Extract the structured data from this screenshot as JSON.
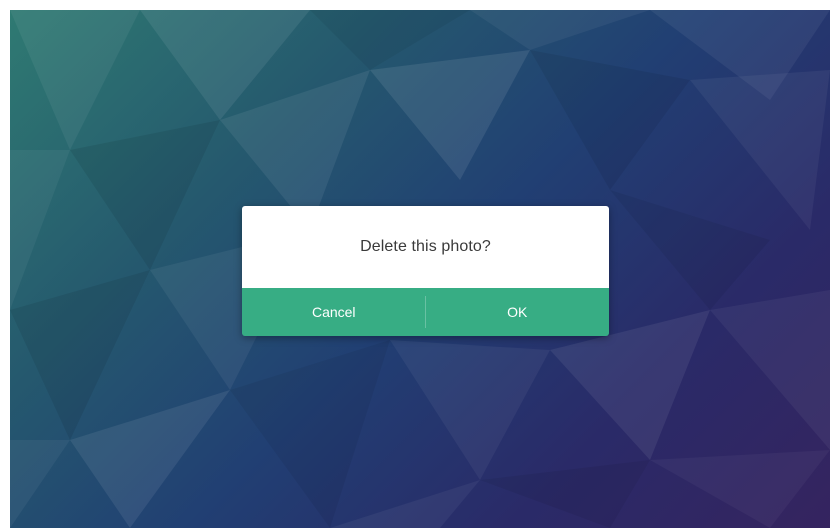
{
  "dialog": {
    "message": "Delete this photo?",
    "cancel_label": "Cancel",
    "ok_label": "OK"
  },
  "colors": {
    "accent": "#37ad84",
    "dialog_background": "#ffffff",
    "message_text": "#3a3a3a"
  }
}
